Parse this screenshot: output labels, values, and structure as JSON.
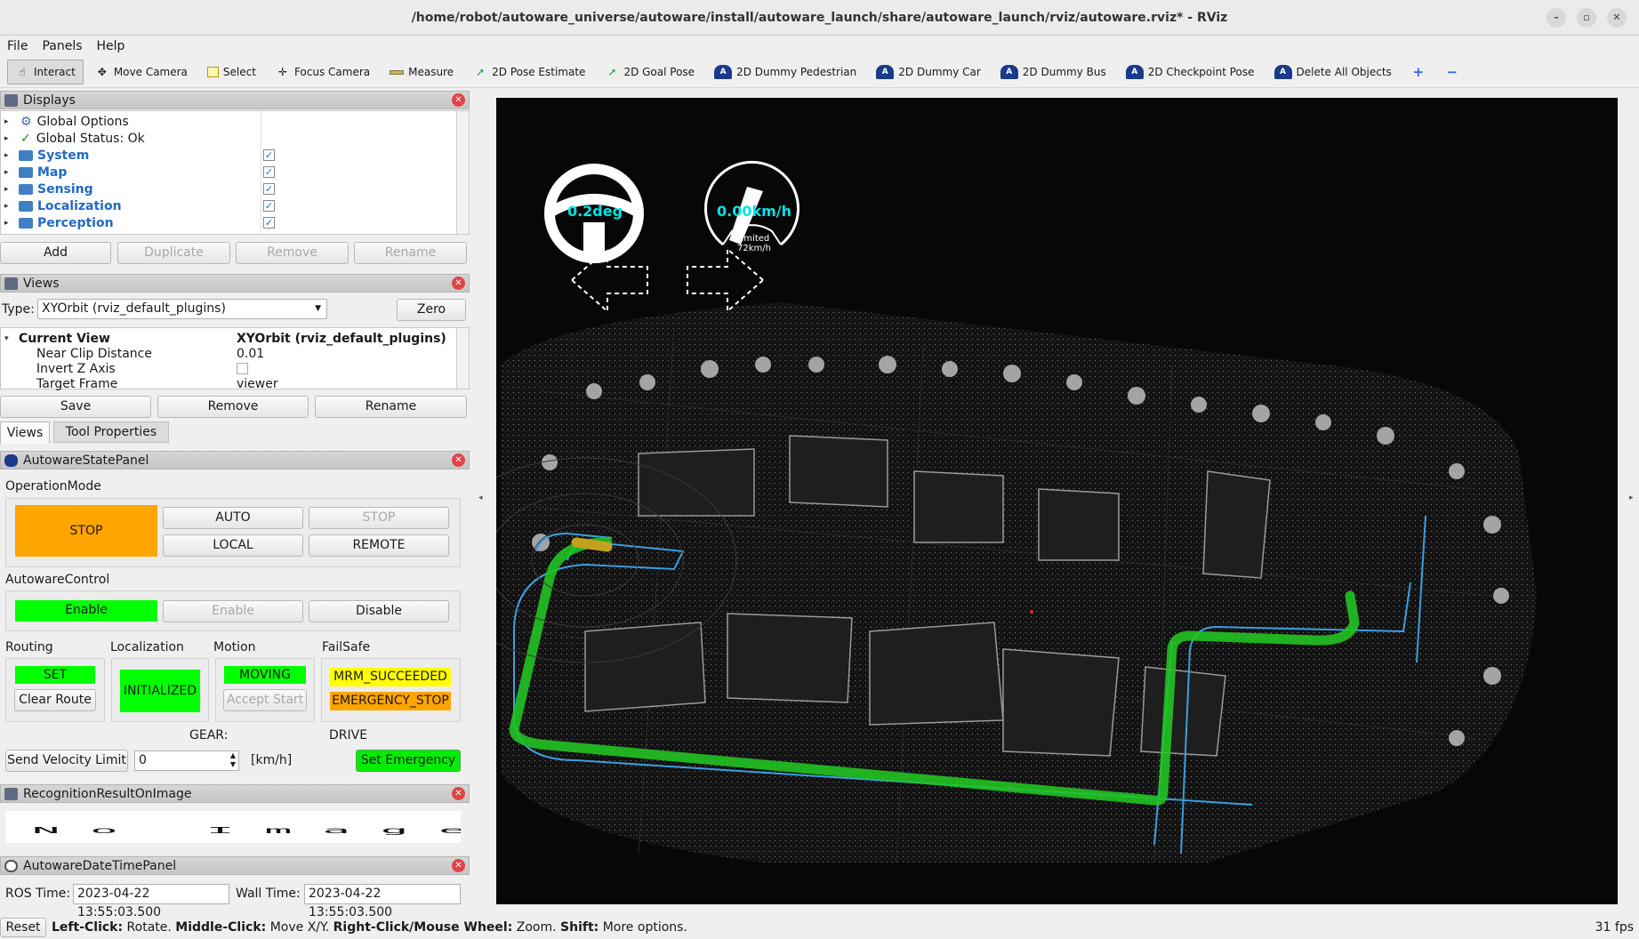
{
  "window": {
    "title": "/home/robot/autoware_universe/autoware/install/autoware_launch/share/autoware_launch/rviz/autoware.rviz* - RViz"
  },
  "menu": [
    "File",
    "Panels",
    "Help"
  ],
  "toolbar": [
    {
      "label": "Interact",
      "icon": "hand-icon",
      "active": true
    },
    {
      "label": "Move Camera",
      "icon": "move-icon"
    },
    {
      "label": "Select",
      "icon": "select-icon"
    },
    {
      "label": "Focus Camera",
      "icon": "focus-icon"
    },
    {
      "label": "Measure",
      "icon": "ruler-icon"
    },
    {
      "label": "2D Pose Estimate",
      "icon": "arrow-green-icon"
    },
    {
      "label": "2D Goal Pose",
      "icon": "arrow-green-icon"
    },
    {
      "label": "2D Dummy Pedestrian",
      "icon": "autoware-icon"
    },
    {
      "label": "2D Dummy Car",
      "icon": "autoware-icon"
    },
    {
      "label": "2D Dummy Bus",
      "icon": "autoware-icon"
    },
    {
      "label": "2D Checkpoint Pose",
      "icon": "autoware-icon"
    },
    {
      "label": "Delete All Objects",
      "icon": "autoware-icon"
    }
  ],
  "displays": {
    "title": "Displays",
    "items": [
      {
        "label": "Global Options",
        "icon": "gear-icon"
      },
      {
        "label": "Global Status: Ok",
        "icon": "check-icon"
      },
      {
        "label": "System",
        "icon": "folder-icon",
        "checked": true
      },
      {
        "label": "Map",
        "icon": "folder-icon",
        "checked": true
      },
      {
        "label": "Sensing",
        "icon": "folder-icon",
        "checked": true
      },
      {
        "label": "Localization",
        "icon": "folder-icon",
        "checked": true
      },
      {
        "label": "Perception",
        "icon": "folder-icon",
        "checked": true
      }
    ],
    "buttons": [
      "Add",
      "Duplicate",
      "Remove",
      "Rename"
    ]
  },
  "views": {
    "title": "Views",
    "type_label": "Type:",
    "type_value": "XYOrbit (rviz_default_plugins)",
    "zero": "Zero",
    "current_view": "Current View",
    "current_view_value": "XYOrbit (rviz_default_plugins)",
    "props": [
      {
        "name": "Near Clip Distance",
        "value": "0.01"
      },
      {
        "name": "Invert Z Axis",
        "value": ""
      },
      {
        "name": "Target Frame",
        "value": "viewer"
      }
    ],
    "buttons": [
      "Save",
      "Remove",
      "Rename"
    ],
    "tabs": [
      "Views",
      "Tool Properties"
    ]
  },
  "state_panel": {
    "title": "AutowareStatePanel",
    "operation_mode": "OperationMode",
    "stop_state": "STOP",
    "auto": "AUTO",
    "stop_btn": "STOP",
    "local": "LOCAL",
    "remote": "REMOTE",
    "autoware_control": "AutowareControl",
    "enable_state": "Enable",
    "enable_btn": "Enable",
    "disable_btn": "Disable",
    "routing": "Routing",
    "routing_state": "SET",
    "clear_route": "Clear Route",
    "localization": "Localization",
    "localization_state": "INITIALIZED",
    "motion": "Motion",
    "motion_state": "MOVING",
    "accept_start": "Accept Start",
    "failsafe": "FailSafe",
    "mrm_state": "MRM_SUCCEEDED",
    "emergency_state": "EMERGENCY_STOP",
    "gear": "GEAR:",
    "drive": "DRIVE",
    "send_velocity": "Send Velocity Limit",
    "velocity_value": "0",
    "velocity_unit": "[km/h]",
    "set_emergency": "Set Emergency",
    "colors": {
      "orange": "#ffa500",
      "green": "#00ff00",
      "yellow": "#ffff00"
    }
  },
  "recognition": {
    "title": "RecognitionResultOnImage",
    "no_image": "No Image"
  },
  "datetime": {
    "title": "AutowareDateTimePanel",
    "ros_label": "ROS Time:",
    "ros_value": "2023-04-22 13:55:03.500",
    "wall_label": "Wall Time:",
    "wall_value": "2023-04-22 13:55:03.500"
  },
  "viewport": {
    "steering": "0.2deg",
    "speed": "0.00km/h",
    "limited_label": "limited",
    "limited_value": "72km/h",
    "text_color": "#00e5e5"
  },
  "status": {
    "reset": "Reset",
    "hint_parts": [
      {
        "b": "Left-Click:",
        "t": " Rotate. "
      },
      {
        "b": "Middle-Click:",
        "t": " Move X/Y. "
      },
      {
        "b": "Right-Click/Mouse Wheel:",
        "t": " Zoom. "
      },
      {
        "b": "Shift:",
        "t": " More options."
      }
    ],
    "fps": "31 fps"
  }
}
